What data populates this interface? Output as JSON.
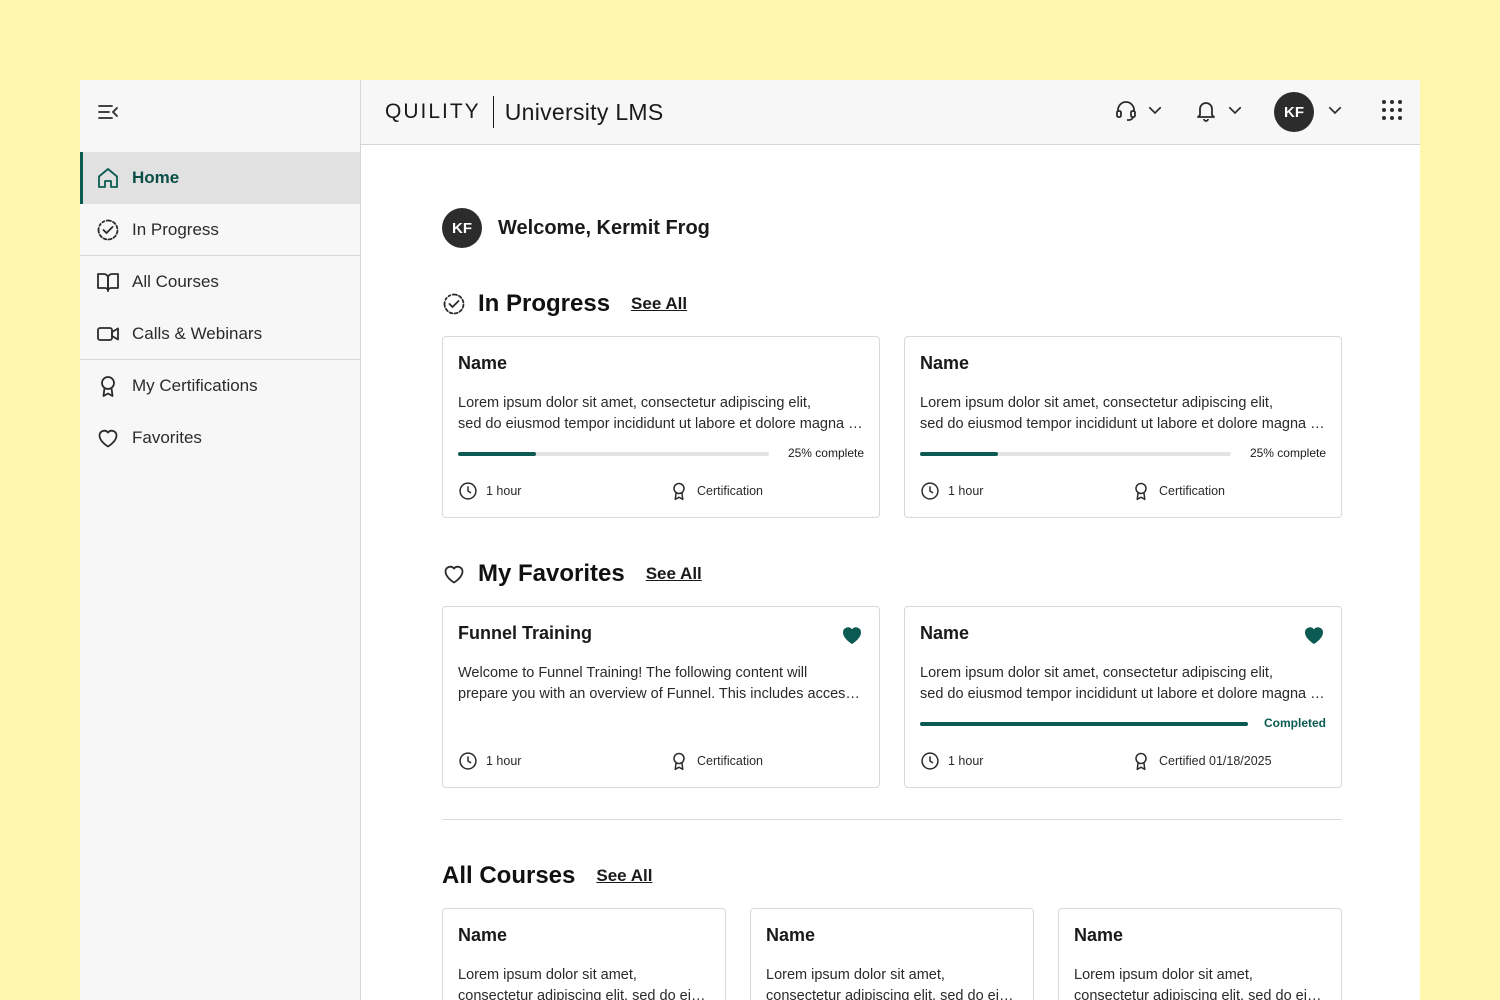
{
  "app": {
    "logo": "QUILITY",
    "title": "University LMS"
  },
  "user": {
    "initials": "KF",
    "welcome": "Welcome, Kermit Frog"
  },
  "sidebar": {
    "items": [
      {
        "label": "Home",
        "icon": "home-icon"
      },
      {
        "label": "In Progress",
        "icon": "progress-check-icon"
      },
      {
        "label": "All Courses",
        "icon": "book-icon"
      },
      {
        "label": "Calls & Webinars",
        "icon": "video-icon"
      },
      {
        "label": "My Certifications",
        "icon": "award-icon"
      },
      {
        "label": "Favorites",
        "icon": "heart-icon"
      }
    ]
  },
  "topbar": {
    "support_icon": "headset-icon",
    "notifications_icon": "bell-icon",
    "apps_icon": "grid-icon"
  },
  "in_progress": {
    "title": "In Progress",
    "see_all": "See All",
    "cards": [
      {
        "name": "Name",
        "desc1": "Lorem ipsum dolor sit amet, consectetur adipiscing elit,",
        "desc2": "sed do eiusmod tempor incididunt ut labore et dolore magna aliqua.",
        "progress": 0.25,
        "progress_label": "25% complete",
        "duration": "1 hour",
        "cert": "Certification"
      },
      {
        "name": "Name",
        "desc1": "Lorem ipsum dolor sit amet, consectetur adipiscing elit,",
        "desc2": "sed do eiusmod tempor incididunt ut labore et dolore magna aliqua.",
        "progress": 0.25,
        "progress_label": "25% complete",
        "duration": "1 hour",
        "cert": "Certification"
      }
    ]
  },
  "favorites": {
    "title": "My Favorites",
    "see_all": "See All",
    "cards": [
      {
        "name": "Funnel Training",
        "desc1": "Welcome to Funnel Training! The following content will",
        "desc2": "prepare you with an overview of Funnel. This includes accessing the platform.",
        "duration": "1 hour",
        "cert": "Certification"
      },
      {
        "name": "Name",
        "desc1": "Lorem ipsum dolor sit amet, consectetur adipiscing elit,",
        "desc2": "sed do eiusmod tempor incididunt ut labore et dolore magna aliqua.",
        "progress": 1.0,
        "progress_label": "Completed",
        "duration": "1 hour",
        "cert": "Certified 01/18/2025"
      }
    ],
    "accent": "#0b5b52"
  },
  "all_courses": {
    "title": "All Courses",
    "see_all": "See All",
    "cards": [
      {
        "name": "Name",
        "desc1": "Lorem ipsum dolor sit amet,",
        "desc2": "consectetur adipiscing elit, sed do eiusmod tempor"
      },
      {
        "name": "Name",
        "desc1": "Lorem ipsum dolor sit amet,",
        "desc2": "consectetur adipiscing elit, sed do eiusmod tempor"
      },
      {
        "name": "Name",
        "desc1": "Lorem ipsum dolor sit amet,",
        "desc2": "consectetur adipiscing elit, sed do eiusmod tempor"
      }
    ]
  }
}
